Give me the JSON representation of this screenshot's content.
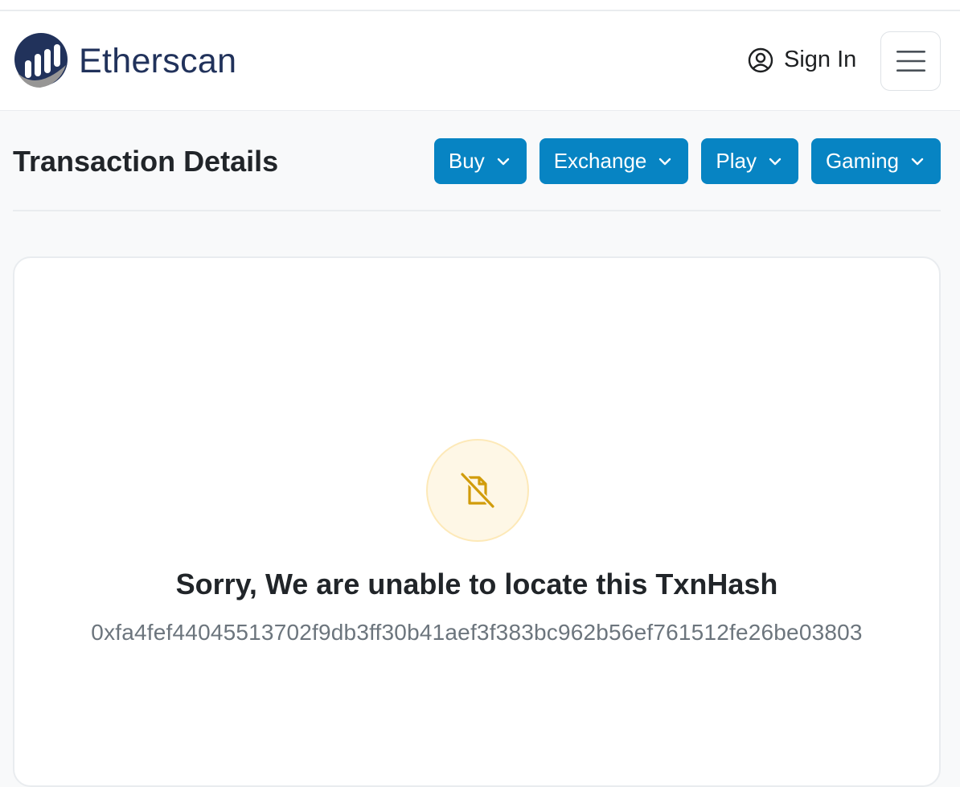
{
  "brand": {
    "name": "Etherscan"
  },
  "header": {
    "signin_label": "Sign In"
  },
  "page": {
    "title": "Transaction Details"
  },
  "actions": [
    {
      "label": "Buy"
    },
    {
      "label": "Exchange"
    },
    {
      "label": "Play"
    },
    {
      "label": "Gaming"
    }
  ],
  "empty_state": {
    "message": "Sorry, We are unable to locate this TxnHash",
    "hash": "0xfa4fef44045513702f9db3ff30b41aef3f383bc962b56ef761512fe26be03803",
    "icon": "file-slash-icon"
  },
  "colors": {
    "primary": "#0784c3",
    "brand_dark": "#21325b",
    "warning_icon": "#d19c0b",
    "warning_bg": "#fef7e6"
  }
}
